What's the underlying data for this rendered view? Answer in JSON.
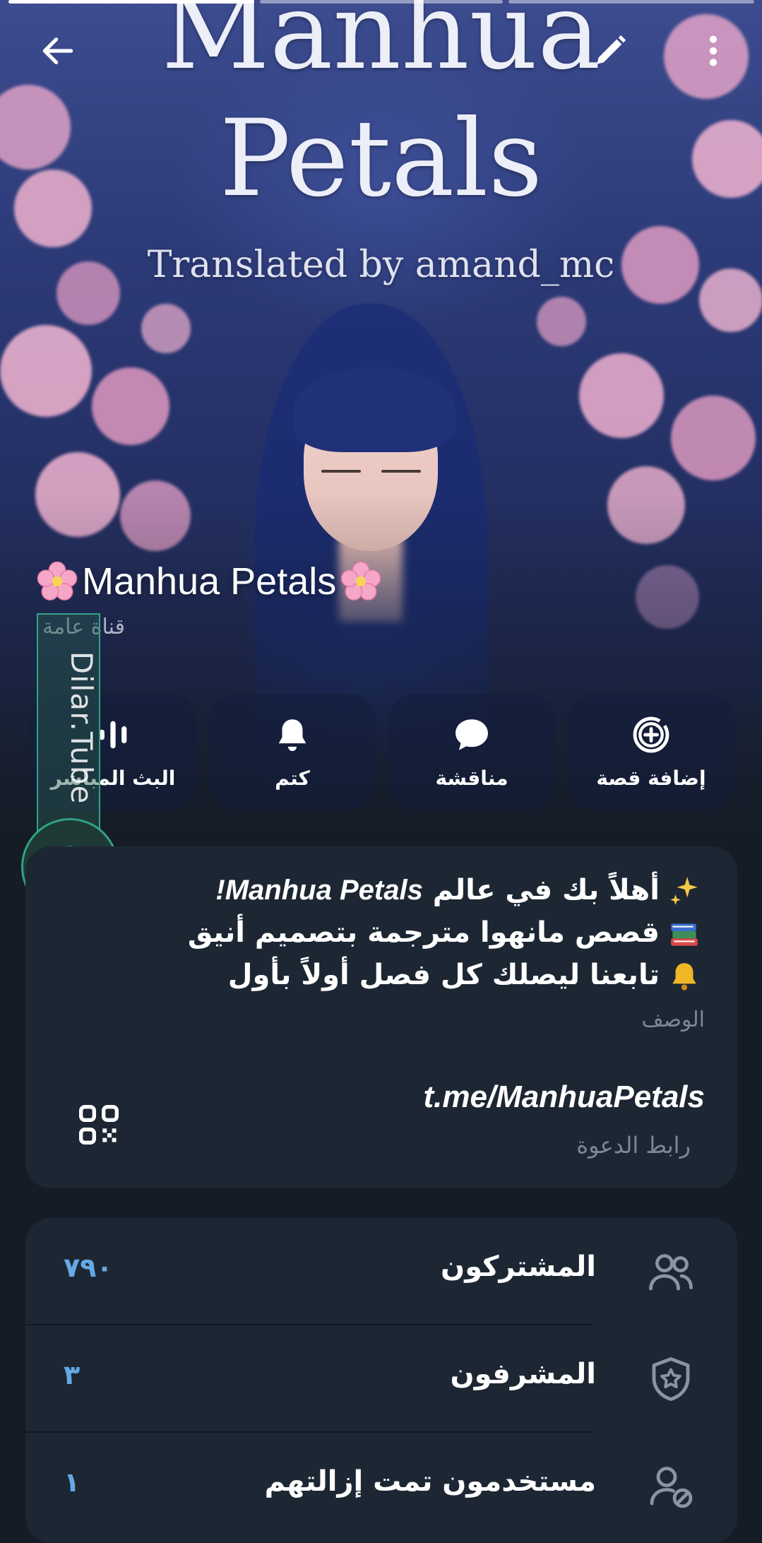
{
  "header": {
    "cover_line1": "Manhua",
    "cover_line2": "Petals",
    "cover_line3": "Translated by amand_mc",
    "story_segments": 3
  },
  "channel": {
    "name": "Manhua Petals",
    "type": "قناة عامة"
  },
  "actions": [
    {
      "label": "إضافة قصة",
      "icon": "add-story-icon"
    },
    {
      "label": "مناقشة",
      "icon": "chat-bubble-icon"
    },
    {
      "label": "كتم",
      "icon": "bell-icon"
    },
    {
      "label": "البث المباشر",
      "icon": "live-stream-icon"
    }
  ],
  "watermark": {
    "text": "Dilar.Tube"
  },
  "description": {
    "line1_prefix": "أهلاً بك في عالم ",
    "line1_brand": "Manhua Petals!",
    "line2": "قصص مانهوا مترجمة بتصميم أنيق",
    "line3": "تابعنا ليصلك كل فصل أولاً بأول",
    "label": "الوصف"
  },
  "invite": {
    "link": "t.me/ManhuaPetals",
    "label": "رابط الدعوة"
  },
  "stats": [
    {
      "label": "المشتركون",
      "count": "٧٩٠",
      "icon": "subscribers-icon"
    },
    {
      "label": "المشرفون",
      "count": "٣",
      "icon": "admins-shield-icon"
    },
    {
      "label": "مستخدمون تمت إزالتهم",
      "count": "١",
      "icon": "removed-users-icon"
    }
  ],
  "colors": {
    "background": "#151c26",
    "card": "#1d2733",
    "accent_count": "#64a8e6",
    "muted_text": "#7d8795"
  }
}
